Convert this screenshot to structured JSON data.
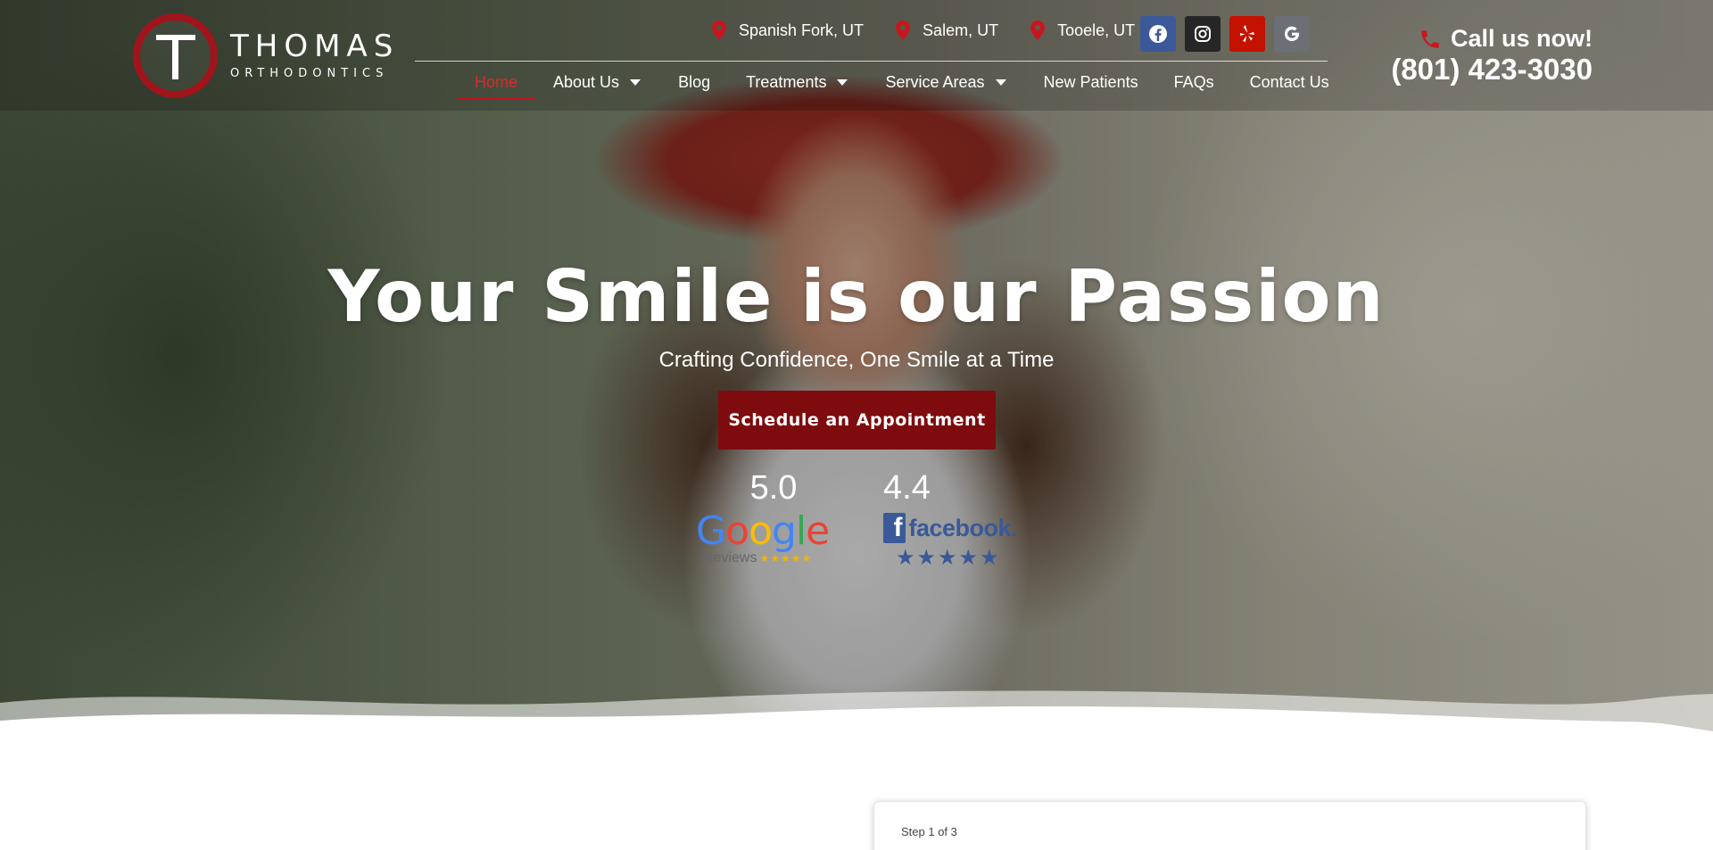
{
  "brand": {
    "name": "THOMAS",
    "sub": "ORTHODONTICS",
    "icon": "t-logo-icon",
    "accent": "#a0141c"
  },
  "locations": [
    {
      "label": "Spanish Fork, UT",
      "icon": "map-pin-icon"
    },
    {
      "label": "Salem, UT",
      "icon": "map-pin-icon"
    },
    {
      "label": "Tooele, UT",
      "icon": "map-pin-icon"
    }
  ],
  "socials": [
    {
      "name": "facebook",
      "icon": "facebook-icon",
      "color": "#3b5998"
    },
    {
      "name": "instagram",
      "icon": "instagram-icon",
      "color": "#262626"
    },
    {
      "name": "yelp",
      "icon": "yelp-icon",
      "color": "#c41200"
    },
    {
      "name": "google",
      "icon": "google-icon",
      "color": "#6c6f76"
    }
  ],
  "nav": [
    {
      "label": "Home",
      "active": true,
      "dropdown": false
    },
    {
      "label": "About Us",
      "active": false,
      "dropdown": true
    },
    {
      "label": "Blog",
      "active": false,
      "dropdown": false
    },
    {
      "label": "Treatments",
      "active": false,
      "dropdown": true
    },
    {
      "label": "Service Areas",
      "active": false,
      "dropdown": true
    },
    {
      "label": "New Patients",
      "active": false,
      "dropdown": false
    },
    {
      "label": "FAQs",
      "active": false,
      "dropdown": false
    },
    {
      "label": "Contact Us",
      "active": false,
      "dropdown": false
    }
  ],
  "call": {
    "label": "Call us now!",
    "phone": "(801) 423-3030",
    "icon": "phone-icon"
  },
  "hero": {
    "headline": "Your Smile is our Passion",
    "subhead": "Crafting Confidence, One Smile at a Time",
    "cta": "Schedule an Appointment",
    "cta_color": "#7e0b0e"
  },
  "reviews": {
    "google": {
      "score": "5.0",
      "word": "Google",
      "sub": "Reviews",
      "stars": "★★★★★"
    },
    "facebook": {
      "score": "4.4",
      "word": "facebook.",
      "stars": "★★★★★",
      "color": "#3b5998"
    }
  },
  "form": {
    "step": "Step 1 of 3"
  }
}
